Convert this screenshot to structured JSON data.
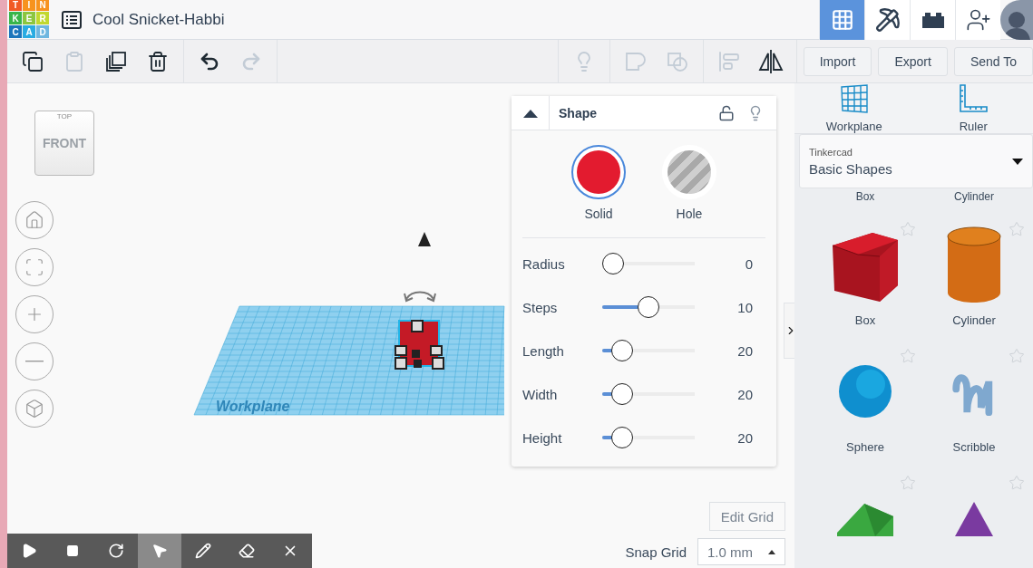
{
  "logo": [
    {
      "letter": "T",
      "color": "#f15a24"
    },
    {
      "letter": "I",
      "color": "#f7931e"
    },
    {
      "letter": "N",
      "color": "#f7931e"
    },
    {
      "letter": "K",
      "color": "#39b54a"
    },
    {
      "letter": "E",
      "color": "#8cc63f"
    },
    {
      "letter": "R",
      "color": "#c1d82f"
    },
    {
      "letter": "C",
      "color": "#1b75bc"
    },
    {
      "letter": "A",
      "color": "#29abe2"
    },
    {
      "letter": "D",
      "color": "#6fb7e0"
    }
  ],
  "title": "Cool Snicket-Habbi",
  "top_nav": [
    {
      "kind": "grid",
      "selected": true
    },
    {
      "kind": "pickaxe",
      "selected": false
    },
    {
      "kind": "bricks",
      "selected": false
    },
    {
      "kind": "add-user",
      "selected": false
    },
    {
      "kind": "avatar",
      "selected": false
    }
  ],
  "toolbar_groups": [
    [
      {
        "kind": "copy",
        "disabled": false
      },
      {
        "kind": "paste",
        "disabled": true
      },
      {
        "kind": "duplicate",
        "disabled": false
      },
      {
        "kind": "delete",
        "disabled": false
      }
    ],
    [
      {
        "kind": "undo",
        "disabled": false
      },
      {
        "kind": "redo",
        "disabled": true
      }
    ],
    [
      {
        "kind": "note",
        "disabled": true
      }
    ],
    [
      {
        "kind": "group",
        "disabled": true
      },
      {
        "kind": "ungroup",
        "disabled": true
      }
    ],
    [
      {
        "kind": "align",
        "disabled": true
      },
      {
        "kind": "mirror",
        "disabled": false
      }
    ]
  ],
  "actions": [
    "Import",
    "Export",
    "Send To"
  ],
  "view_cube": {
    "top": "TOP",
    "front": "FRONT"
  },
  "view_controls": [
    {
      "kind": "home"
    },
    {
      "kind": "fit"
    },
    {
      "kind": "zoom-in"
    },
    {
      "kind": "zoom-out"
    },
    {
      "kind": "ortho"
    }
  ],
  "workplane_label": "Workplane",
  "shape_panel": {
    "title": "Shape",
    "locked": false,
    "modes": [
      {
        "label": "Solid",
        "kind": "solid",
        "selected": true
      },
      {
        "label": "Hole",
        "kind": "hole",
        "selected": false
      }
    ],
    "params": [
      {
        "label": "Radius",
        "level": 0,
        "reading": "0"
      },
      {
        "label": "Steps",
        "level": 0.5,
        "reading": "10"
      },
      {
        "label": "Length",
        "level": 0.13,
        "reading": "20"
      },
      {
        "label": "Width",
        "level": 0.13,
        "reading": "20"
      },
      {
        "label": "Height",
        "level": 0.13,
        "reading": "20"
      }
    ]
  },
  "edit_grid": "Edit Grid",
  "snap_grid": {
    "label": "Snap Grid",
    "value": "1.0 mm"
  },
  "sim_toolbar": [
    {
      "kind": "play",
      "selected": false
    },
    {
      "kind": "stop",
      "selected": false
    },
    {
      "kind": "reset",
      "selected": false
    },
    {
      "kind": "select",
      "selected": true
    },
    {
      "kind": "pencil",
      "selected": false
    },
    {
      "kind": "eraser",
      "selected": false
    },
    {
      "kind": "close",
      "selected": false
    }
  ],
  "tools": [
    {
      "label": "Workplane",
      "kind": "workplane"
    },
    {
      "label": "Ruler",
      "kind": "ruler"
    }
  ],
  "library": {
    "source": "Tinkercad",
    "category": "Basic Shapes"
  },
  "clipped_labels": [
    "Box",
    "Cylinder"
  ],
  "shapes": [
    {
      "label": "Box",
      "kind": "box"
    },
    {
      "label": "Cylinder",
      "kind": "cylinder"
    },
    {
      "label": "Sphere",
      "kind": "sphere"
    },
    {
      "label": "Scribble",
      "kind": "scribble"
    },
    {
      "kind": "roof"
    },
    {
      "kind": "cone"
    }
  ]
}
